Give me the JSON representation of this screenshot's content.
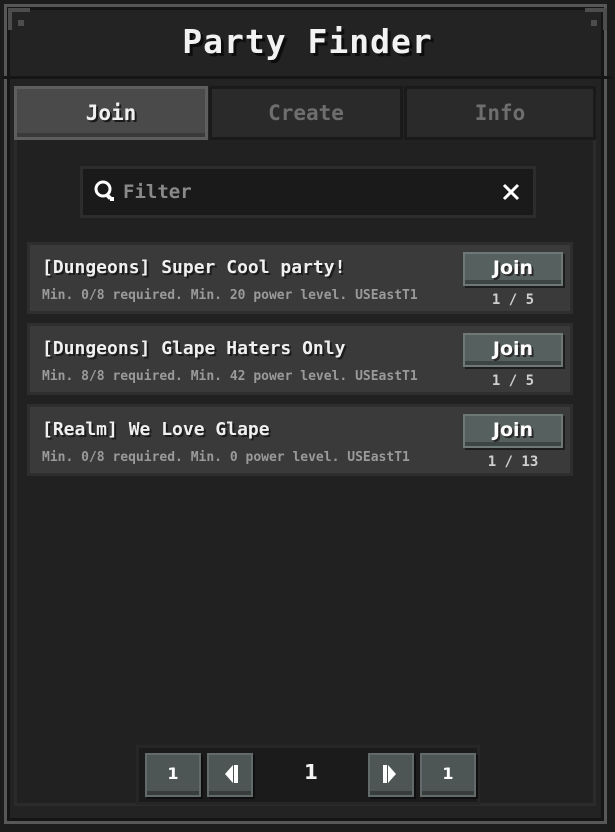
{
  "window": {
    "title": "Party Finder"
  },
  "tabs": [
    {
      "label": "Join",
      "active": true
    },
    {
      "label": "Create",
      "active": false
    },
    {
      "label": "Info",
      "active": false
    }
  ],
  "search": {
    "placeholder": "Filter",
    "value": ""
  },
  "parties": [
    {
      "name": "[Dungeons] Super Cool party!",
      "requirements": "Min. 0/8 required. Min. 20 power level. USEastT1",
      "join_label": "Join",
      "count": "1 / 5"
    },
    {
      "name": "[Dungeons] Glape Haters Only",
      "requirements": "Min. 8/8 required. Min. 42 power level. USEastT1",
      "join_label": "Join",
      "count": "1 / 5"
    },
    {
      "name": "[Realm] We Love Glape",
      "requirements": "Min. 0/8 required. Min. 0 power level. USEastT1",
      "join_label": "Join",
      "count": "1 / 13"
    }
  ],
  "pagination": {
    "first_label": "1",
    "current": "1",
    "last_label": "1"
  },
  "colors": {
    "panel": "#232323",
    "row": "#3a3a3a",
    "button": "#56605e",
    "text": "#f0f0f0"
  }
}
